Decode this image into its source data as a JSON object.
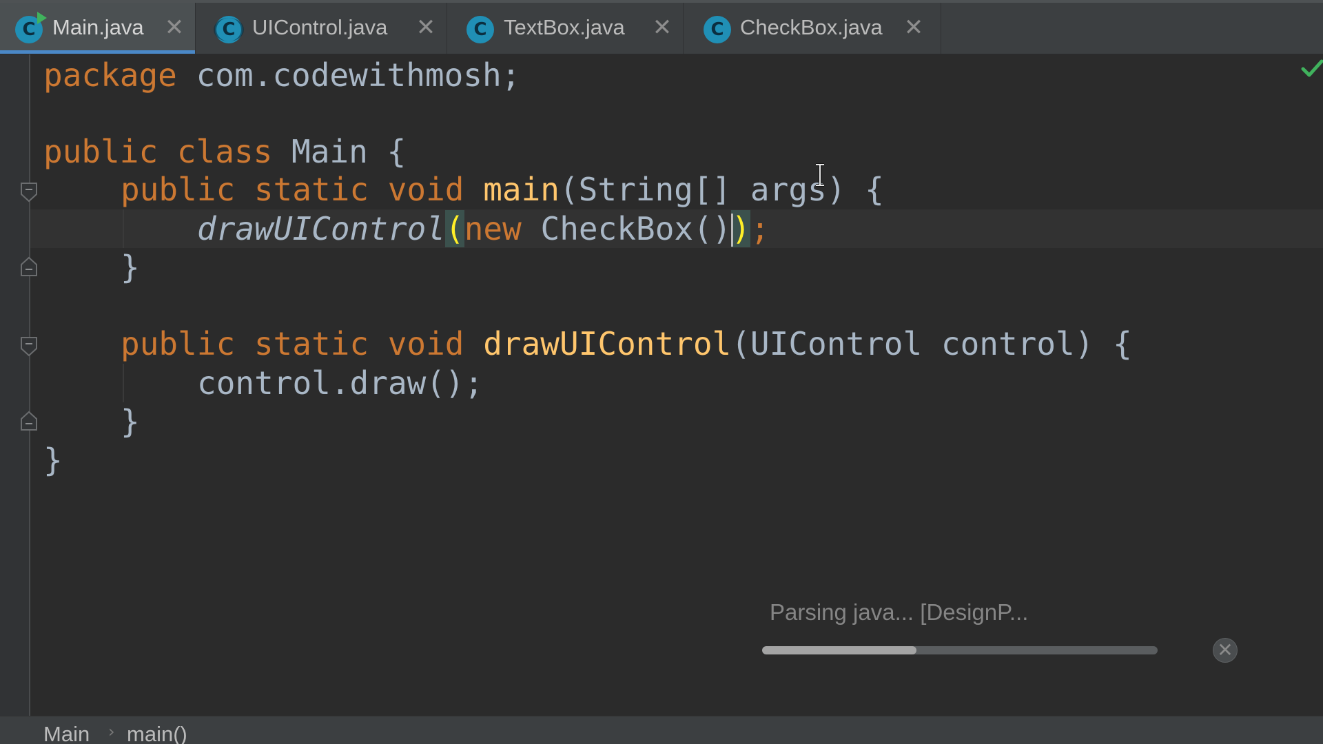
{
  "tabs": [
    {
      "label": "Main.java",
      "icon": "java-class-run-icon",
      "active": true
    },
    {
      "label": "UIControl.java",
      "icon": "java-abstract-class-icon",
      "active": false
    },
    {
      "label": "TextBox.java",
      "icon": "java-class-icon",
      "active": false
    },
    {
      "label": "CheckBox.java",
      "icon": "java-class-icon",
      "active": false
    }
  ],
  "tab_icon_letter": "C",
  "tab_close_glyph": "✕",
  "code": {
    "l1_kw": "package",
    "l1_rest": " com.codewithmosh;",
    "l3_kw": "public class",
    "l3_rest": " Main {",
    "l4_kw": "public static void",
    "l4_fn": "main",
    "l4_rest": "(String[] args) {",
    "l5_call": "drawUIControl",
    "l5_open": "(",
    "l5_kw": "new",
    "l5_mid": " CheckBox()",
    "l5_close": ")",
    "l5_end": ";",
    "l6": "}",
    "l8_kw": "public static void",
    "l8_fn": "drawUIControl",
    "l8_rest": "(UIControl control) {",
    "l9": "control.draw();",
    "l10": "}",
    "l11": "}"
  },
  "progress": {
    "text": "Parsing java... [DesignP...",
    "fraction": 0.39,
    "cancel_glyph": "✕"
  },
  "breadcrumb": {
    "items": [
      "Main",
      "main()"
    ],
    "separator": "›"
  },
  "colors": {
    "background": "#2b2b2b",
    "keyword": "#cc7832",
    "function": "#ffc66d",
    "text": "#a9b7c6",
    "accent": "#4a88c7",
    "ok": "#40b25d"
  }
}
